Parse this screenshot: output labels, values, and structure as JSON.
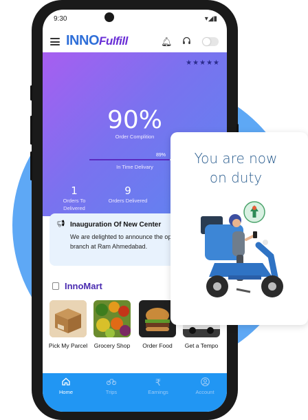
{
  "status_bar": {
    "time": "9:30"
  },
  "app": {
    "logo_inno": "INNO",
    "logo_fulfill": "Fulfill"
  },
  "hero": {
    "rating_stars": "★★★★★",
    "order_completion_value": "90%",
    "order_completion_label": "Order Complition",
    "in_time_percent_label": "89%",
    "in_time_fraction": 0.89,
    "in_time_label": "In Time Delivary",
    "stats": [
      {
        "value": "1",
        "label": "Orders To Delivered"
      },
      {
        "value": "9",
        "label": "Orders Delivered"
      }
    ]
  },
  "notice": {
    "title": "Inauguration Of New Center",
    "body": "We are delighted to announce the opening our new branch at Ram Ahmedabad."
  },
  "innomart": {
    "title": "InnoMart",
    "items": [
      {
        "label": "Pick My Parcel",
        "icon": "parcel-box-icon"
      },
      {
        "label": "Grocery Shop",
        "icon": "vegetables-icon"
      },
      {
        "label": "Order Food",
        "icon": "burger-icon"
      },
      {
        "label": "Get a Tempo",
        "icon": "truck-icon"
      }
    ]
  },
  "bottom_nav": {
    "items": [
      {
        "label": "Home",
        "icon": "home-icon",
        "active": true
      },
      {
        "label": "Trips",
        "icon": "bike-icon",
        "active": false
      },
      {
        "label": "Earnings",
        "icon": "rupee-icon",
        "active": false
      },
      {
        "label": "Account",
        "icon": "account-icon",
        "active": false
      }
    ]
  },
  "duty_card": {
    "message": "You are now on duty"
  },
  "colors": {
    "accent_blue": "#2196f3",
    "hero_gradient_start": "#a75ef0",
    "hero_gradient_end": "#5b86f0",
    "brand_purple": "#4a2bb0"
  }
}
